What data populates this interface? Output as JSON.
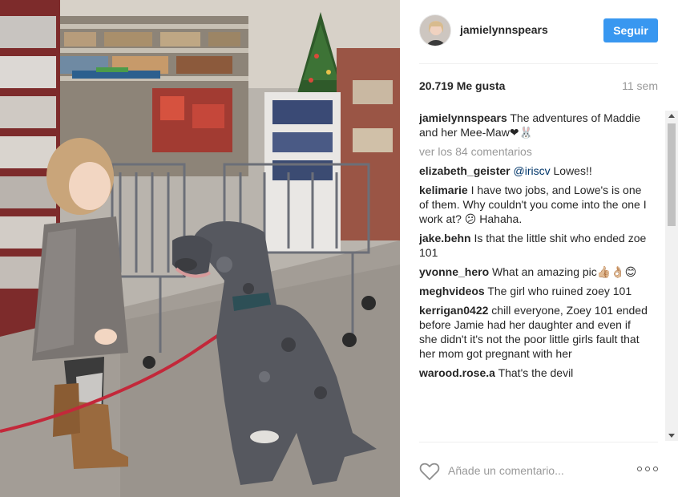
{
  "post": {
    "username": "jamielynnspears",
    "follow_label": "Seguir",
    "likes": "20.719 Me gusta",
    "time_ago": "11 sem"
  },
  "caption": {
    "username": "jamielynnspears",
    "text": "The adventures of Maddie and her Mee-Maw",
    "emoji": "❤🐰"
  },
  "view_all_comments": "ver los 84 comentarios",
  "comments": [
    {
      "user": "elizabeth_geister",
      "mention": "@iriscv",
      "text": "Lowes!!"
    },
    {
      "user": "kelimarie",
      "mention": "",
      "text": "I have two jobs, and Lowe's is one of them. Why couldn't you come into the one I work at? 😕 Hahaha."
    },
    {
      "user": "jake.behn",
      "mention": "",
      "text": "Is that the little shit who ended zoe 101"
    },
    {
      "user": "yvonne_hero",
      "mention": "",
      "text": "What an amazing pic👍🏼👌🏼😊"
    },
    {
      "user": "meghvideos",
      "mention": "",
      "text": "The girl who ruined zoey 101"
    },
    {
      "user": "kerrigan0422",
      "mention": "",
      "text": "chill everyone, Zoey 101 ended before Jamie had her daughter and even if she didn't it's not the poor little girls fault that her mom got pregnant with her"
    },
    {
      "user": "warood.rose.a",
      "mention": "",
      "text": "That's the devil"
    }
  ],
  "footer": {
    "comment_placeholder": "Añade un comentario...",
    "more_options": "ooo"
  },
  "colors": {
    "accent": "#3897f0",
    "text": "#262626",
    "muted": "#999999",
    "mention": "#003569"
  },
  "icons": {
    "heart": "heart-outline-icon",
    "more": "more-options-icon"
  }
}
